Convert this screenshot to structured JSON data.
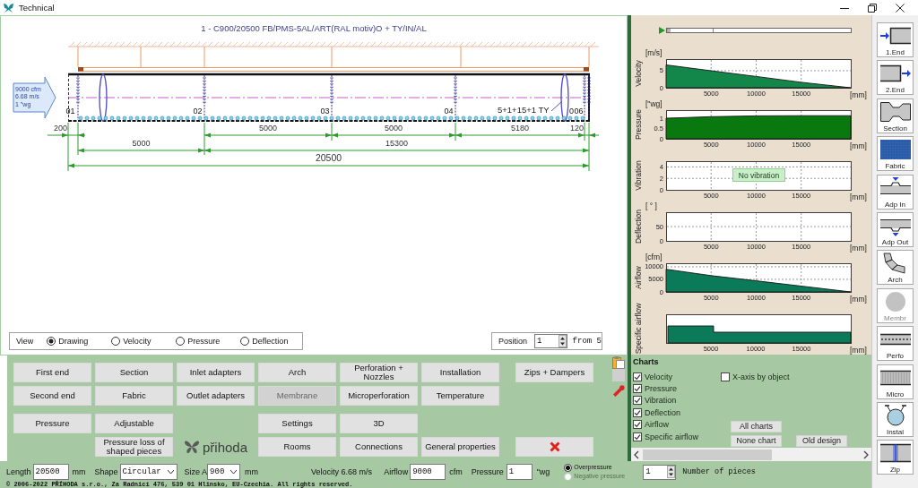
{
  "window": {
    "title": "Technical"
  },
  "drawing": {
    "title": "1 - C900/20500 FB/PMS-5AL/ART(RAL motiv)O + TY/IN/AL",
    "inlet": [
      "9000 cfm",
      "6.68 m/s",
      "1 \"wg"
    ],
    "section_marks": [
      "01",
      "02",
      "03",
      "04",
      "0",
      "06"
    ],
    "nozzle_label": "5+1+15+1 TY",
    "dimension_rows": [
      [
        "200",
        "5000",
        "5000",
        "5180",
        "120"
      ],
      [
        "5000",
        "15300"
      ],
      [
        "20500"
      ]
    ]
  },
  "view": {
    "label": "View",
    "options": [
      {
        "label": "Drawing",
        "selected": true
      },
      {
        "label": "Velocity",
        "selected": false
      },
      {
        "label": "Pressure",
        "selected": false
      },
      {
        "label": "Deflection",
        "selected": false
      }
    ]
  },
  "position": {
    "label": "Position",
    "value": "1",
    "total": "from 5"
  },
  "button_panel": {
    "buttons": [
      {
        "kind": "text",
        "label": "First end",
        "disabled": false
      },
      {
        "kind": "text",
        "label": "Section",
        "disabled": false
      },
      {
        "kind": "text",
        "label": "Inlet adapters",
        "disabled": false
      },
      {
        "kind": "text",
        "label": "Arch",
        "disabled": false
      },
      {
        "kind": "text",
        "label": "Perforation + Nozzles",
        "disabled": false
      },
      {
        "kind": "text",
        "label": "Installation",
        "disabled": false
      },
      {
        "kind": "text",
        "label": "Zips + Dampers",
        "disabled": false
      },
      {
        "kind": "text",
        "label": "Second end",
        "disabled": false
      },
      {
        "kind": "text",
        "label": "Fabric",
        "disabled": false
      },
      {
        "kind": "text",
        "label": "Outlet adapters",
        "disabled": false
      },
      {
        "kind": "text",
        "label": "Membrane",
        "disabled": true
      },
      {
        "kind": "text",
        "label": "Microperforation",
        "disabled": false
      },
      {
        "kind": "text",
        "label": "Temperature",
        "disabled": false
      },
      {
        "kind": "text",
        "label": "Pressure",
        "disabled": false
      },
      {
        "kind": "text",
        "label": "Adjustable",
        "disabled": false
      },
      {
        "kind": "text",
        "label": "Settings",
        "disabled": false
      },
      {
        "kind": "text",
        "label": "3D",
        "disabled": false
      },
      {
        "kind": "text",
        "label": "Pressure loss of shaped pieces",
        "disabled": false
      },
      {
        "kind": "text",
        "label": "Rooms",
        "disabled": false
      },
      {
        "kind": "text",
        "label": "Connections",
        "disabled": false
      },
      {
        "kind": "text",
        "label": "General properties",
        "disabled": false
      },
      {
        "kind": "cancel",
        "disabled": false
      }
    ],
    "logo": "přihoda"
  },
  "charts": [
    {
      "kind": "plain",
      "unit": "[m/s]",
      "chart_data": {
        "type": "area",
        "ylabel": "Velocity",
        "xlabel": "[mm]",
        "x": [
          0,
          5000,
          10000,
          15000,
          20500
        ],
        "xlim": [
          0,
          20500
        ],
        "ylim": [
          0,
          8.4
        ],
        "xticks": [
          5000,
          10000,
          15000
        ],
        "yticks": [
          0,
          5
        ],
        "grid": true,
        "series": [
          {
            "color": "#13874a",
            "values": [
              6.7,
              5.0,
              3.3,
              1.6,
              0
            ]
          }
        ]
      }
    },
    {
      "kind": "plain",
      "unit": "[\"wg]",
      "chart_data": {
        "type": "area",
        "ylabel": "Pressure",
        "xlabel": "[mm]",
        "x": [
          0,
          5000,
          10000,
          15000,
          20500
        ],
        "xlim": [
          0,
          20500
        ],
        "ylim": [
          0,
          1.4
        ],
        "xticks": [
          5000,
          10000,
          15000
        ],
        "yticks": [
          0,
          0.5,
          1
        ],
        "grid": true,
        "series": [
          {
            "color": "#08780f",
            "values": [
              1.0,
              1.08,
              1.12,
              1.13,
              1.13
            ]
          }
        ]
      }
    },
    {
      "kind": "empty",
      "note": "No vibration",
      "chart_data": {
        "type": "line",
        "ylabel": "Vibration",
        "xlabel": "[mm]",
        "xlim": [
          0,
          20500
        ],
        "ylim": [
          0,
          5
        ],
        "xticks": [
          5000,
          10000,
          15000
        ],
        "yticks": [
          0,
          2,
          4
        ],
        "grid": true
      }
    },
    {
      "kind": "empty",
      "unit": "[ ° ]",
      "chart_data": {
        "type": "line",
        "ylabel": "Deflection",
        "xlabel": "[mm]",
        "xlim": [
          0,
          20500
        ],
        "ylim": [
          0,
          100
        ],
        "xticks": [
          5000,
          10000,
          15000
        ],
        "yticks": [
          0,
          50
        ],
        "grid": true
      }
    },
    {
      "kind": "plain",
      "unit": "[cfm]",
      "chart_data": {
        "type": "area",
        "ylabel": "Airflow",
        "xlabel": "[mm]",
        "x": [
          0,
          5000,
          10000,
          15000,
          20500
        ],
        "xlim": [
          0,
          20500
        ],
        "ylim": [
          0,
          11400
        ],
        "xticks": [
          5000,
          10000,
          15000
        ],
        "yticks": [
          0,
          5000,
          10000
        ],
        "grid": true,
        "series": [
          {
            "color": "#0b7a58",
            "values": [
              9000,
              6500,
              4400,
              2300,
              0
            ]
          }
        ]
      }
    },
    {
      "kind": "picture",
      "title": "Specific airflow",
      "x_labels": [
        "5000",
        "10000",
        "15000"
      ],
      "axis_unit": "[mm]"
    }
  ],
  "chart_options": {
    "title": "Charts",
    "items": [
      {
        "label": "Velocity",
        "checked": true
      },
      {
        "label": "Pressure",
        "checked": true
      },
      {
        "label": "Vibration",
        "checked": true
      },
      {
        "label": "Deflection",
        "checked": true
      },
      {
        "label": "Airflow",
        "checked": true
      },
      {
        "label": "Specific airflow",
        "checked": true
      }
    ],
    "x_axis": {
      "label": "X-axis by object",
      "checked": false
    },
    "buttons": [
      "All charts",
      "None chart",
      "Old design"
    ]
  },
  "status_bar": {
    "length": {
      "label": "Length",
      "value": "20500",
      "unit": "mm"
    },
    "shape": {
      "label": "Shape",
      "value": "Circular"
    },
    "size": {
      "label": "Size A",
      "value": "900",
      "unit": "mm"
    },
    "velocity": "Velocity 6.68 m/s",
    "airflow": {
      "label": "Airflow",
      "value": "9000",
      "unit": "cfm"
    },
    "pressure": {
      "label": "Pressure",
      "value": "1",
      "unit": "\"wg"
    },
    "pressure_mode": [
      {
        "label": "Overpressure",
        "selected": true,
        "disabled": false
      },
      {
        "label": "Negative pressure",
        "selected": false,
        "disabled": true
      }
    ],
    "pieces": {
      "value": "1",
      "label": "Number of pieces"
    },
    "copyright": "© 2006-2022 PŘÍHODA s.r.o., Za Radnicí 476, 539 01 Hlinsko, EU-Czechia. All rights reserved."
  },
  "toolbar": [
    {
      "kind": "first-end",
      "label": "1.End",
      "disabled": false
    },
    {
      "kind": "second-end",
      "label": "2.End",
      "disabled": false
    },
    {
      "kind": "section",
      "label": "Section",
      "disabled": false
    },
    {
      "kind": "fabric",
      "label": "Fabric",
      "disabled": false
    },
    {
      "kind": "adapter-in",
      "label": "Adp In",
      "disabled": false
    },
    {
      "kind": "adapter-out",
      "label": "Adp Out",
      "disabled": false
    },
    {
      "kind": "arch",
      "label": "Arch",
      "disabled": false
    },
    {
      "kind": "membrane",
      "label": "Membr",
      "disabled": true
    },
    {
      "kind": "perforation",
      "label": "Perfo",
      "disabled": false
    },
    {
      "kind": "microperforation",
      "label": "Micro",
      "disabled": false
    },
    {
      "kind": "installation",
      "label": "Instal",
      "disabled": false
    },
    {
      "kind": "zip",
      "label": "Zip",
      "disabled": false
    }
  ]
}
